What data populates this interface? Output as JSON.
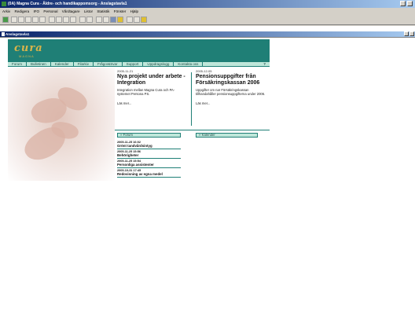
{
  "window": {
    "title": "(0A) Magna Cura - Äldre- och handikappomsorg - Anslagstavla1",
    "child_title": "Anslagstavla1"
  },
  "menu": [
    "Arkiv",
    "Redigera",
    "IFO",
    "Personal",
    "Vårdtagare",
    "Listor",
    "Statistik",
    "Fönster",
    "Hjälp"
  ],
  "brand": {
    "logo": "cura",
    "sub": "MAGNA"
  },
  "nav": [
    "Forum",
    "Bulletinen",
    "Kalender",
    "Filarkiv",
    "Frågor&Svar",
    "Support",
    "Uppdragslogg",
    "Kontakta oss",
    "?"
  ],
  "news": [
    {
      "date": "2005-11-21",
      "title": "Nya projekt under arbete - Integration",
      "body": "Integration mellan Magna Cura och PA-systemet Persona PS.",
      "more": "Läs mer..."
    },
    {
      "date": "2005-12-05",
      "title": "Pensionsuppgifter från Försäkringskassan 2006",
      "body": "Uppgifter om nar Försäkringskassan tillhandahåller pensionsuppgifterna under 2006.",
      "more": "Läs mer..."
    }
  ],
  "forum": {
    "header": "Forum",
    "items": [
      {
        "date": "2005-11-25 16:02",
        "title": "Grönt tandvårdsintyg"
      },
      {
        "date": "2005-11-25 15:56",
        "title": "Behörigheter"
      },
      {
        "date": "2005-11-25 15:54",
        "title": "Personliga assistenter"
      },
      {
        "date": "2005-10-31 17:45",
        "title": "Redovisning av egna medel"
      }
    ]
  },
  "calendar": {
    "header": "Kalender"
  },
  "colors": {
    "brand_teal": "#1f7f76",
    "nav_bg": "#bfe7da",
    "logo_gold": "#d9b44a"
  }
}
